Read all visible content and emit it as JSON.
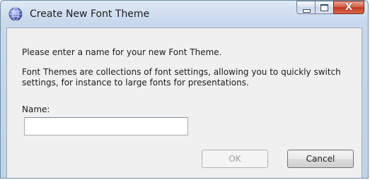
{
  "window": {
    "title": "Create New Font Theme",
    "app_icon": "globe-icon",
    "close_glyph": "X"
  },
  "content": {
    "prompt": "Please enter a name for your new Font Theme.",
    "description": "Font Themes are collections of font settings, allowing you to quickly switch settings, for instance to large fonts for presentations.",
    "name_label": "Name:",
    "name_value": ""
  },
  "buttons": {
    "ok_label": "OK",
    "ok_enabled": false,
    "cancel_label": "Cancel"
  }
}
